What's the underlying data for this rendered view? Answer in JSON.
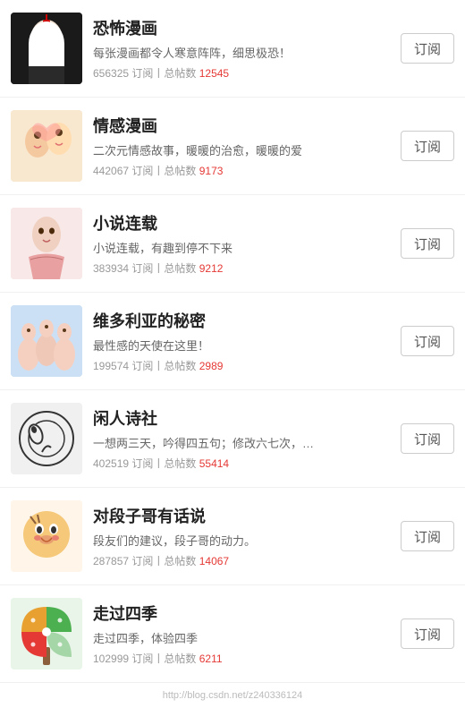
{
  "items": [
    {
      "id": 1,
      "title": "恐怖漫画",
      "desc": "每张漫画都令人寒意阵阵，细思极恐！",
      "subscribers": "656325",
      "total_posts": "12545",
      "subscribe_label": "订阅",
      "avatar_color": "#1a1a1a",
      "avatar_type": "horror"
    },
    {
      "id": 2,
      "title": "情感漫画",
      "desc": "二次元情感故事，暖暖的治愈，暖暖的爱",
      "subscribers": "442067",
      "total_posts": "9173",
      "subscribe_label": "订阅",
      "avatar_color": "#f5e6c8",
      "avatar_type": "romance"
    },
    {
      "id": 3,
      "title": "小说连载",
      "desc": "小说连载，有趣到停不下来",
      "subscribers": "383934",
      "total_posts": "9212",
      "subscribe_label": "订阅",
      "avatar_color": "#f0d0d0",
      "avatar_type": "novel"
    },
    {
      "id": 4,
      "title": "维多利亚的秘密",
      "desc": "最性感的天使在这里！",
      "subscribers": "199574",
      "total_posts": "2989",
      "subscribe_label": "订阅",
      "avatar_color": "#cce4f5",
      "avatar_type": "victoria"
    },
    {
      "id": 5,
      "title": "闲人诗社",
      "desc": "一想两三天，吟得四五句；修改六七次，…",
      "subscribers": "402519",
      "total_posts": "55414",
      "subscribe_label": "订阅",
      "avatar_color": "#f5f5f5",
      "avatar_type": "poetry"
    },
    {
      "id": 6,
      "title": "对段子哥有话说",
      "desc": "段友们的建议，段子哥的动力。",
      "subscribers": "287857",
      "total_posts": "14067",
      "subscribe_label": "订阅",
      "avatar_color": "#fff0e0",
      "avatar_type": "joke"
    },
    {
      "id": 7,
      "title": "走过四季",
      "desc": "走过四季，体验四季",
      "subscribers": "102999",
      "total_posts": "6211",
      "subscribe_label": "订阅",
      "avatar_color": "#e8f5e8",
      "avatar_type": "seasons"
    }
  ],
  "stats_label": "订阅",
  "stats_separator": "丨总帖数",
  "watermark": "http://blog.csdn.net/z240336124"
}
